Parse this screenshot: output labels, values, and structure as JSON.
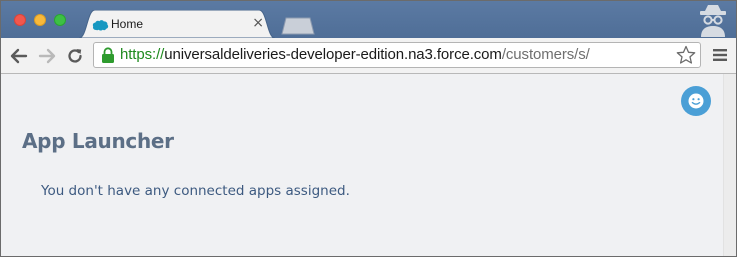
{
  "browser": {
    "tab": {
      "title": "Home",
      "close_glyph": "×",
      "favicon": "salesforce-cloud-icon"
    },
    "address_bar": {
      "scheme": "https://",
      "host": "universaldeliveries-developer-edition.na3.force.com",
      "path": "/customers/s/"
    },
    "icons": {
      "back": "back-arrow-icon",
      "forward": "forward-arrow-icon",
      "reload": "reload-icon",
      "lock": "lock-icon",
      "bookmark": "star-icon",
      "menu": "hamburger-menu-icon",
      "incognito": "incognito-icon"
    },
    "colors": {
      "titlebar": "#5677a0",
      "secure_scheme": "#1e8a1e"
    }
  },
  "page": {
    "title": "App Launcher",
    "empty_message": "You don't have any connected apps assigned.",
    "colors": {
      "background": "#f0f1f3",
      "title": "#5c6f86",
      "message": "#3d5a80",
      "avatar": "#4a9fd6"
    }
  }
}
